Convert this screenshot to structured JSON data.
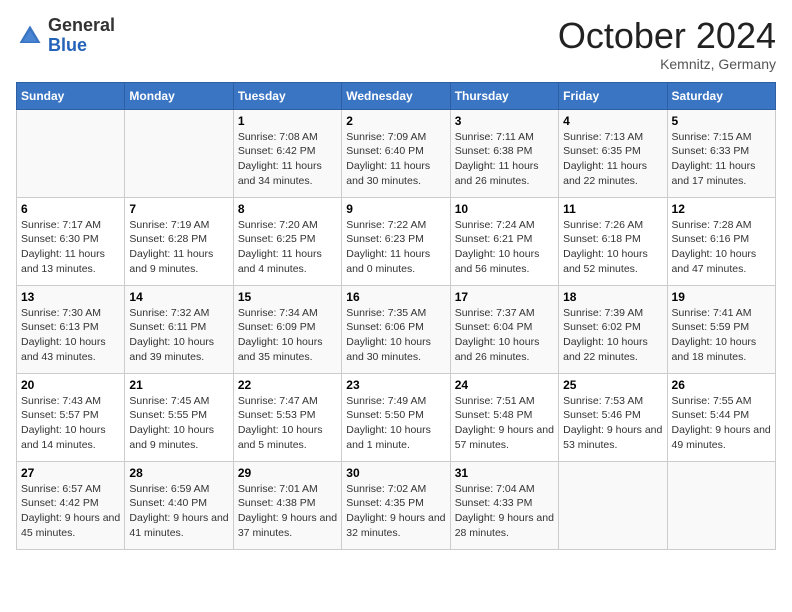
{
  "header": {
    "logo_general": "General",
    "logo_blue": "Blue",
    "month": "October 2024",
    "location": "Kemnitz, Germany"
  },
  "weekdays": [
    "Sunday",
    "Monday",
    "Tuesday",
    "Wednesday",
    "Thursday",
    "Friday",
    "Saturday"
  ],
  "weeks": [
    [
      {
        "day": "",
        "info": ""
      },
      {
        "day": "",
        "info": ""
      },
      {
        "day": "1",
        "info": "Sunrise: 7:08 AM\nSunset: 6:42 PM\nDaylight: 11 hours and 34 minutes."
      },
      {
        "day": "2",
        "info": "Sunrise: 7:09 AM\nSunset: 6:40 PM\nDaylight: 11 hours and 30 minutes."
      },
      {
        "day": "3",
        "info": "Sunrise: 7:11 AM\nSunset: 6:38 PM\nDaylight: 11 hours and 26 minutes."
      },
      {
        "day": "4",
        "info": "Sunrise: 7:13 AM\nSunset: 6:35 PM\nDaylight: 11 hours and 22 minutes."
      },
      {
        "day": "5",
        "info": "Sunrise: 7:15 AM\nSunset: 6:33 PM\nDaylight: 11 hours and 17 minutes."
      }
    ],
    [
      {
        "day": "6",
        "info": "Sunrise: 7:17 AM\nSunset: 6:30 PM\nDaylight: 11 hours and 13 minutes."
      },
      {
        "day": "7",
        "info": "Sunrise: 7:19 AM\nSunset: 6:28 PM\nDaylight: 11 hours and 9 minutes."
      },
      {
        "day": "8",
        "info": "Sunrise: 7:20 AM\nSunset: 6:25 PM\nDaylight: 11 hours and 4 minutes."
      },
      {
        "day": "9",
        "info": "Sunrise: 7:22 AM\nSunset: 6:23 PM\nDaylight: 11 hours and 0 minutes."
      },
      {
        "day": "10",
        "info": "Sunrise: 7:24 AM\nSunset: 6:21 PM\nDaylight: 10 hours and 56 minutes."
      },
      {
        "day": "11",
        "info": "Sunrise: 7:26 AM\nSunset: 6:18 PM\nDaylight: 10 hours and 52 minutes."
      },
      {
        "day": "12",
        "info": "Sunrise: 7:28 AM\nSunset: 6:16 PM\nDaylight: 10 hours and 47 minutes."
      }
    ],
    [
      {
        "day": "13",
        "info": "Sunrise: 7:30 AM\nSunset: 6:13 PM\nDaylight: 10 hours and 43 minutes."
      },
      {
        "day": "14",
        "info": "Sunrise: 7:32 AM\nSunset: 6:11 PM\nDaylight: 10 hours and 39 minutes."
      },
      {
        "day": "15",
        "info": "Sunrise: 7:34 AM\nSunset: 6:09 PM\nDaylight: 10 hours and 35 minutes."
      },
      {
        "day": "16",
        "info": "Sunrise: 7:35 AM\nSunset: 6:06 PM\nDaylight: 10 hours and 30 minutes."
      },
      {
        "day": "17",
        "info": "Sunrise: 7:37 AM\nSunset: 6:04 PM\nDaylight: 10 hours and 26 minutes."
      },
      {
        "day": "18",
        "info": "Sunrise: 7:39 AM\nSunset: 6:02 PM\nDaylight: 10 hours and 22 minutes."
      },
      {
        "day": "19",
        "info": "Sunrise: 7:41 AM\nSunset: 5:59 PM\nDaylight: 10 hours and 18 minutes."
      }
    ],
    [
      {
        "day": "20",
        "info": "Sunrise: 7:43 AM\nSunset: 5:57 PM\nDaylight: 10 hours and 14 minutes."
      },
      {
        "day": "21",
        "info": "Sunrise: 7:45 AM\nSunset: 5:55 PM\nDaylight: 10 hours and 9 minutes."
      },
      {
        "day": "22",
        "info": "Sunrise: 7:47 AM\nSunset: 5:53 PM\nDaylight: 10 hours and 5 minutes."
      },
      {
        "day": "23",
        "info": "Sunrise: 7:49 AM\nSunset: 5:50 PM\nDaylight: 10 hours and 1 minute."
      },
      {
        "day": "24",
        "info": "Sunrise: 7:51 AM\nSunset: 5:48 PM\nDaylight: 9 hours and 57 minutes."
      },
      {
        "day": "25",
        "info": "Sunrise: 7:53 AM\nSunset: 5:46 PM\nDaylight: 9 hours and 53 minutes."
      },
      {
        "day": "26",
        "info": "Sunrise: 7:55 AM\nSunset: 5:44 PM\nDaylight: 9 hours and 49 minutes."
      }
    ],
    [
      {
        "day": "27",
        "info": "Sunrise: 6:57 AM\nSunset: 4:42 PM\nDaylight: 9 hours and 45 minutes."
      },
      {
        "day": "28",
        "info": "Sunrise: 6:59 AM\nSunset: 4:40 PM\nDaylight: 9 hours and 41 minutes."
      },
      {
        "day": "29",
        "info": "Sunrise: 7:01 AM\nSunset: 4:38 PM\nDaylight: 9 hours and 37 minutes."
      },
      {
        "day": "30",
        "info": "Sunrise: 7:02 AM\nSunset: 4:35 PM\nDaylight: 9 hours and 32 minutes."
      },
      {
        "day": "31",
        "info": "Sunrise: 7:04 AM\nSunset: 4:33 PM\nDaylight: 9 hours and 28 minutes."
      },
      {
        "day": "",
        "info": ""
      },
      {
        "day": "",
        "info": ""
      }
    ]
  ]
}
